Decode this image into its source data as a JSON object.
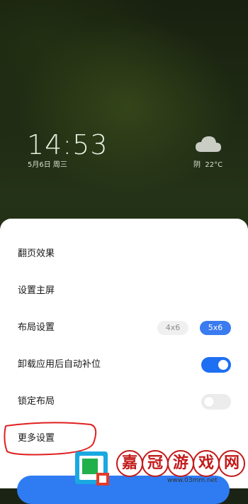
{
  "lockscreen": {
    "time": "14:53",
    "date": "5月6日 周三",
    "weather": {
      "icon": "cloud-icon",
      "condition": "阴",
      "temperature": "22°C"
    }
  },
  "settings_sheet": {
    "items": [
      {
        "label": "翻页效果"
      },
      {
        "label": "设置主屏"
      },
      {
        "label": "布局设置",
        "options": [
          "4x6",
          "5x6"
        ],
        "selected": "5x6"
      },
      {
        "label": "卸载应用后自动补位",
        "toggle": true
      },
      {
        "label": "锁定布局",
        "toggle": false
      },
      {
        "label": "更多设置"
      }
    ],
    "accent_color": "#1e6ff2"
  },
  "watermark": {
    "characters": [
      "嘉",
      "冠",
      "游",
      "戏",
      "网"
    ],
    "url": "www.03mm.net"
  }
}
